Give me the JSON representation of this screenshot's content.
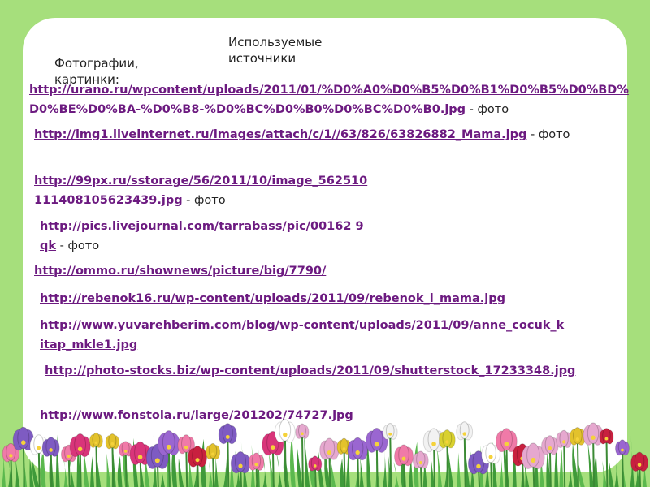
{
  "slide": {
    "title": "Используемые источники",
    "subtitle": "Фотографии, картинки:"
  },
  "colors": {
    "background": "#a6df7c",
    "card": "#ffffff",
    "link": "#6c1a80",
    "text": "#222222"
  },
  "decoration": "flower-border",
  "sources": [
    {
      "url": "http://urano.ru/wpcontent/uploads/2011/01/%D0%A0%D0%B5%D0%B1%D0%B5%D0%BD%D0%BE%D0%BA-%D0%B8-%D0%BC%D0%B0%D0%BC%D0%B0.jpg",
      "suffix": " - фото"
    },
    {
      "url": "http://img1.liveinternet.ru/images/attach/c/1//63/826/63826882_Mama.jpg",
      "suffix": " - фото"
    },
    {
      "url": "http://99px.ru/sstorage/56/2011/10/image_562510111408105623439.jpg",
      "suffix": " - фото"
    },
    {
      "url": "http://pics.livejournal.com/tarrabass/pic/00162 9qk",
      "suffix": " - фото"
    },
    {
      "url": "http://ommo.ru/shownews/picture/big/7790/",
      "suffix": ""
    },
    {
      "url": "http://rebenok16.ru/wp-content/uploads/2011/09/rebenok_i_mama.jpg",
      "suffix": ""
    },
    {
      "url": "http://www.yuvarehberim.com/blog/wp-content/uploads/2011/09/anne_cocuk_kitap_mkle1.jpg",
      "suffix": ""
    },
    {
      "url": "http://photo-stocks.biz/wp-content/uploads/2011/09/shutterstock_17233348.jpg",
      "suffix": ""
    },
    {
      "url": "http://www.fonstola.ru/large/201202/74727.jpg",
      "suffix": ""
    }
  ]
}
